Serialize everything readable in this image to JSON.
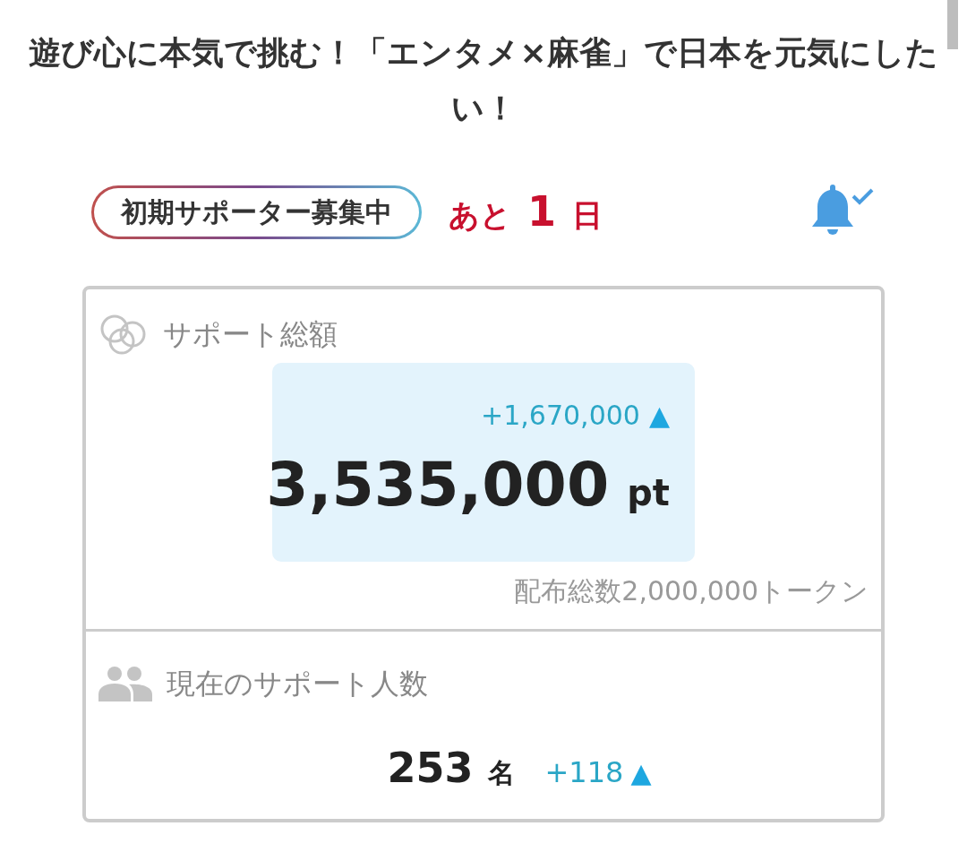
{
  "title": "遊び心に本気で挑む！「エンタメ×麻雀」で日本を元気にしたい！",
  "status": {
    "badge": "初期サポーター募集中",
    "prefix": "あと",
    "count": "1",
    "unit": "日"
  },
  "notification": {
    "subscribed": true
  },
  "total": {
    "label": "サポート総額",
    "change": "+1,670,000",
    "change_arrow": "▲",
    "amount": "3,535,000",
    "unit": "pt",
    "note": "配布総数2,000,000トークン"
  },
  "supporters": {
    "label": "現在のサポート人数",
    "count": "253",
    "unit": "名",
    "change": "+118",
    "change_arrow": "▲"
  }
}
